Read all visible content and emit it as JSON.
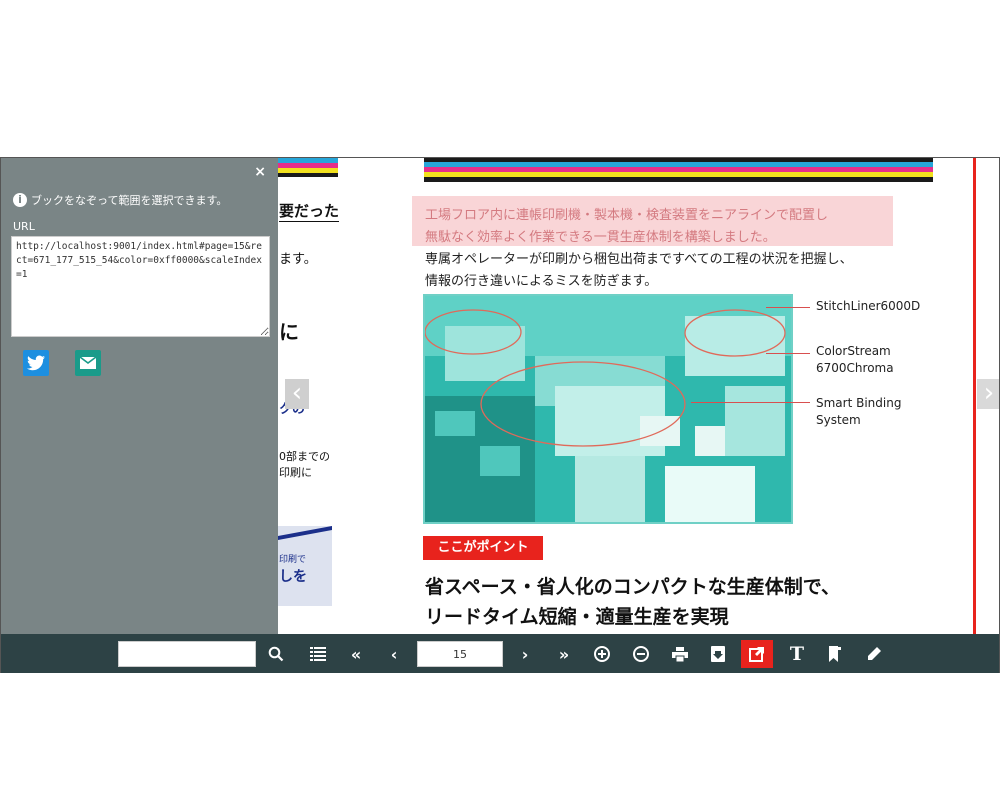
{
  "share_panel": {
    "instruction": "ブックをなぞって範囲を選択できます。",
    "url_label": "URL",
    "url_value": "http://localhost:9001/index.html#page=15&rect=671_177_515_54&color=0xff0000&scaleIndex=1",
    "close_symbol": "×",
    "twitter_icon": "twitter-icon",
    "mail_icon": "mail-icon"
  },
  "left_page": {
    "heading_fragment": "要だった",
    "line1": "ます。",
    "fragment_ni": "に",
    "fragment_ku": "クの",
    "fragment_a": "0部までの",
    "fragment_b": "印刷に",
    "fragment_c": "印刷で",
    "fragment_d": "しを"
  },
  "right_page": {
    "highlight_line1": "工場フロア内に連帳印刷機・製本機・検査装置をニアラインで配置し",
    "highlight_line2": "無駄なく効率よく作業できる一貫生産体制を構築しました。",
    "body_line1": "専属オペレーターが印刷から梱包出荷まですべての工程の状況を把握し、",
    "body_line2": "情報の行き違いによるミスを防ぎます。",
    "callouts": [
      {
        "label": "StitchLiner6000D"
      },
      {
        "label": "ColorStream\n6700Chroma"
      },
      {
        "label": "Smart Binding\nSystem"
      }
    ],
    "point_badge": "ここがポイント",
    "headline1": "省スペース・省人化のコンパクトな生産体制で、",
    "headline2": "リードタイム短縮・適量生産を実現"
  },
  "toolbar": {
    "search_value": "",
    "page_number": "15",
    "icons": [
      "search-icon",
      "list-icon",
      "first-page-icon",
      "prev-page-icon",
      "next-page-icon",
      "last-page-icon",
      "zoom-in-icon",
      "zoom-out-icon",
      "print-icon",
      "download-icon",
      "share-icon",
      "text-icon",
      "bookmark-icon",
      "pen-icon"
    ]
  },
  "colors": {
    "toolbar_bg": "#2d4245",
    "panel_bg": "#7a8586",
    "accent_red": "#e8231d",
    "highlight_pink": "#f9d5d7",
    "twitter_blue": "#1d8fe0",
    "mail_teal": "#1a9b8a"
  }
}
